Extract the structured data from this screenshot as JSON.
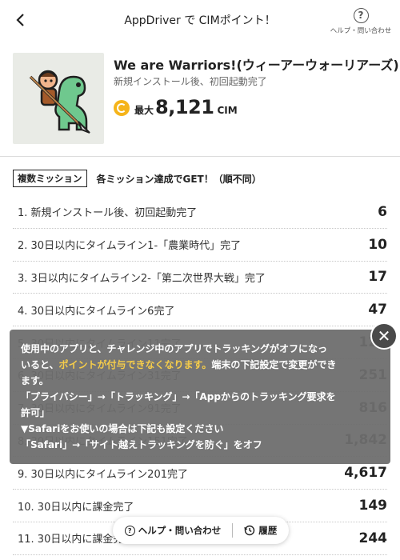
{
  "header": {
    "back_glyph": "‹",
    "title": "AppDriver で CIMポイント！",
    "help_label": "ヘルプ・問い合わせ"
  },
  "app": {
    "name": "We are Warriors!(ウィーアーウォーリアーズ)",
    "subtitle": "新規インストール後、初回起動完了",
    "max_label": "最大",
    "points": "8,121",
    "unit": "CIM"
  },
  "section": {
    "tag": "複数ミッション",
    "note": "各ミッション達成でGET！（順不同）"
  },
  "missions": [
    {
      "text": "1. 新規インストール後、初回起動完了",
      "points": "6"
    },
    {
      "text": "2. 30日以内にタイムライン1-「農業時代」完了",
      "points": "10"
    },
    {
      "text": "3. 3日以内にタイムライン2-「第二次世界大戦」完了",
      "points": "17"
    },
    {
      "text": "4. 30日以内にタイムライン6完了",
      "points": "47"
    },
    {
      "text": "5. 30日以内にタイムライン11完了",
      "points": "127"
    },
    {
      "text": "6. 30日以内にタイムライン31完了",
      "points": "251"
    },
    {
      "text": "7. 30日以内にタイムライン91完了",
      "points": "816"
    },
    {
      "text": "8. 30日以内にタイムライン151完了",
      "points": "1,842"
    },
    {
      "text": "9. 30日以内にタイムライン201完了",
      "points": "4,617"
    },
    {
      "text": "10. 30日以内に課金完了",
      "points": "149"
    },
    {
      "text": "11. 30日以内に課金完了",
      "points": "244"
    }
  ],
  "notice": {
    "line1": "使用中のアプリと、チャレンジ中のアプリでトラッキングがオフになっ",
    "line2_a": "いると、",
    "line2_highlight": "ポイントが付与できなくなります。",
    "line2_b": "端末の下記設定で変更ができ",
    "line3": "ます。",
    "line4": "「プライバシー」→「トラッキング」→「Appからのトラッキング要求を",
    "line5": "許可」",
    "line6": "▼Safariをお使いの場合は下記も設定ください",
    "line7": "「Safari」→「サイト越えトラッキングを防ぐ」をオフ",
    "close_glyph": "✕"
  },
  "floatbar": {
    "help_label": "ヘルプ・問い合わせ",
    "history_label": "履歴"
  },
  "colors": {
    "highlight": "#f6cd4a",
    "coin": "#f5b41a",
    "overlay": "#6e6e6e"
  },
  "icons": [
    "back-icon",
    "help-icon",
    "coin-icon",
    "close-icon",
    "history-icon"
  ]
}
